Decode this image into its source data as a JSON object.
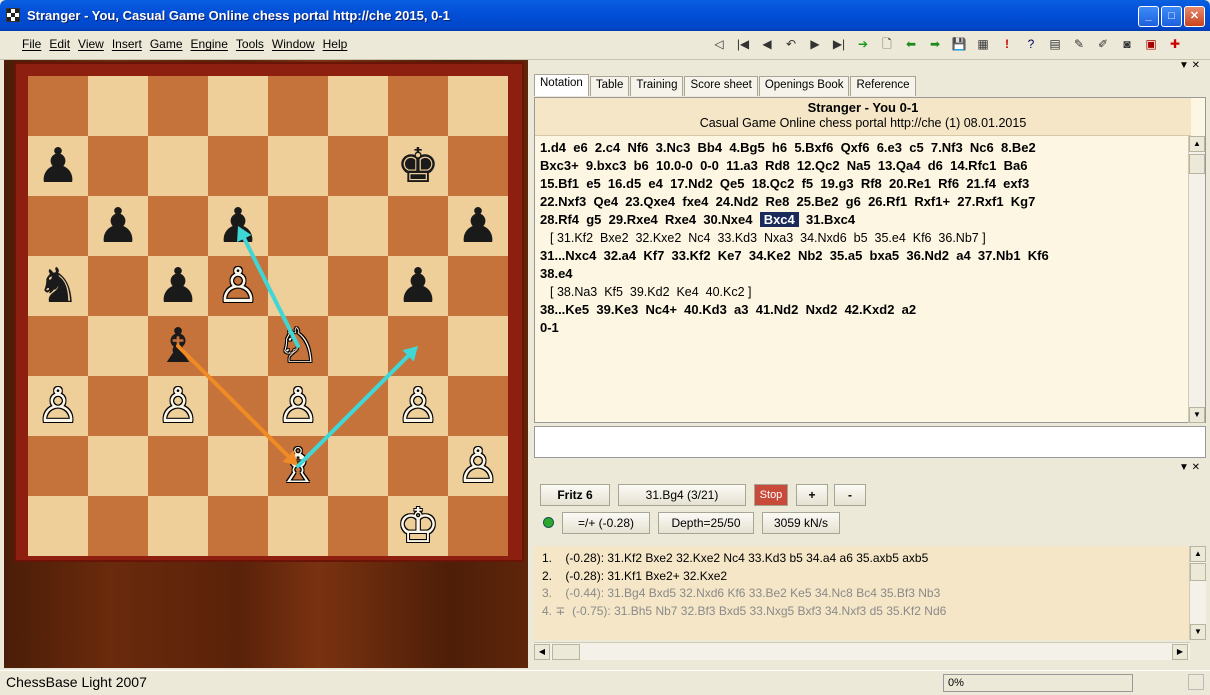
{
  "window": {
    "title": "Stranger - You, Casual Game Online chess portal http://che 2015, 0-1",
    "buttons": [
      "_",
      "□",
      "✕"
    ]
  },
  "menu": [
    "File",
    "Edit",
    "View",
    "Insert",
    "Game",
    "Engine",
    "Tools",
    "Window",
    "Help"
  ],
  "toolbar": [
    "◁",
    "|◀",
    "◀",
    "↶",
    "▶",
    "▶|",
    "➔",
    "🗋",
    "⬅",
    "➡",
    "💾",
    "▦",
    "!",
    "?",
    "▤",
    "✎",
    "✐",
    "◙",
    "▣",
    "✚"
  ],
  "board": {
    "pieces": [
      {
        "sq": "g7",
        "glyph": "♚",
        "color": "b"
      },
      {
        "sq": "a7",
        "glyph": "♟",
        "color": "b"
      },
      {
        "sq": "b6",
        "glyph": "♟",
        "color": "b"
      },
      {
        "sq": "d6",
        "glyph": "♟",
        "color": "b"
      },
      {
        "sq": "h6",
        "glyph": "♟",
        "color": "b"
      },
      {
        "sq": "a5",
        "glyph": "♞",
        "color": "b"
      },
      {
        "sq": "c5",
        "glyph": "♟",
        "color": "b"
      },
      {
        "sq": "d5",
        "glyph": "♙",
        "color": "w"
      },
      {
        "sq": "g5",
        "glyph": "♟",
        "color": "b"
      },
      {
        "sq": "c4",
        "glyph": "♝",
        "color": "b"
      },
      {
        "sq": "e4",
        "glyph": "♘",
        "color": "w"
      },
      {
        "sq": "a3",
        "glyph": "♙",
        "color": "w"
      },
      {
        "sq": "c3",
        "glyph": "♙",
        "color": "w"
      },
      {
        "sq": "e3",
        "glyph": "♙",
        "color": "w"
      },
      {
        "sq": "g3",
        "glyph": "♙",
        "color": "w"
      },
      {
        "sq": "e2",
        "glyph": "♗",
        "color": "w"
      },
      {
        "sq": "h2",
        "glyph": "♙",
        "color": "w"
      },
      {
        "sq": "g1",
        "glyph": "♔",
        "color": "w"
      }
    ],
    "arrows": [
      {
        "from": "c4",
        "to": "e2",
        "color": "#f08a24"
      },
      {
        "from": "e2",
        "to": "g4",
        "color": "#3fd6d6"
      },
      {
        "from": "e4",
        "to": "d6",
        "color": "#3fd6d6"
      }
    ]
  },
  "tabs": [
    "Notation",
    "Table",
    "Training",
    "Score sheet",
    "Openings Book",
    "Reference"
  ],
  "pane_buttons": "▼ ✕",
  "notation": {
    "title": "Stranger - You  0-1",
    "subtitle": "Casual Game Online chess portal http://che (1) 08.01.2015",
    "lines": [
      {
        "t": "m",
        "text": "1.d4  e6  2.c4  Nf6  3.Nc3  Bb4  4.Bg5  h6  5.Bxf6  Qxf6  6.e3  c5  7.Nf3  Nc6  8.Be2"
      },
      {
        "t": "m",
        "text": "Bxc3+  9.bxc3  b6  10.0-0  0-0  11.a3  Rd8  12.Qc2  Na5  13.Qa4  d6  14.Rfc1  Ba6"
      },
      {
        "t": "m",
        "text": "15.Bf1  e5  16.d5  e4  17.Nd2  Qe5  18.Qc2  f5  19.g3  Rf8  20.Re1  Rf6  21.f4  exf3"
      },
      {
        "t": "m",
        "text": "22.Nxf3  Qe4  23.Qxe4  fxe4  24.Nd2  Re8  25.Be2  g6  26.Rf1  Rxf1+  27.Rxf1  Kg7"
      },
      {
        "t": "c",
        "pre": "28.Rf4  g5  29.Rxe4  Rxe4  30.Nxe4  ",
        "cur": "Bxc4",
        "post": "  31.Bxc4"
      },
      {
        "t": "v",
        "text": "[ 31.Kf2  Bxe2  32.Kxe2  Nc4  33.Kd3  Nxa3  34.Nxd6  b5  35.e4  Kf6  36.Nb7 ]"
      },
      {
        "t": "m",
        "text": "31...Nxc4  32.a4  Kf7  33.Kf2  Ke7  34.Ke2  Nb2  35.a5  bxa5  36.Nd2  a4  37.Nb1  Kf6"
      },
      {
        "t": "m",
        "text": "38.e4"
      },
      {
        "t": "v",
        "text": "[ 38.Na3  Kf5  39.Kd2  Ke4  40.Kc2 ]"
      },
      {
        "t": "m",
        "text": "38...Ke5  39.Ke3  Nc4+  40.Kd3  a3  41.Nd2  Nxd2  42.Kxd2  a2"
      },
      {
        "t": "m",
        "text": "0-1"
      }
    ]
  },
  "engine": {
    "name": "Fritz 6",
    "move": "31.Bg4 (3/21)",
    "stop": "Stop",
    "plus": "+",
    "minus": "-",
    "eval": "=/+  (-0.28)",
    "depth": "Depth=25/50",
    "speed": "3059 kN/s",
    "lines": [
      {
        "text": "1.    (-0.28): 31.Kf2 Bxe2 32.Kxe2 Nc4 33.Kd3 b5 34.a4 a6 35.axb5 axb5",
        "grey": false
      },
      {
        "text": "2.    (-0.28): 31.Kf1 Bxe2+ 32.Kxe2",
        "grey": false
      },
      {
        "text": "3.    (-0.44): 31.Bg4 Bxd5 32.Nxd6 Kf6 33.Be2 Ke5 34.Nc8 Bc4 35.Bf3 Nb3",
        "grey": true
      },
      {
        "text": "4. ∓  (-0.75): 31.Bh5 Nb7 32.Bf3 Bxd5 33.Nxg5 Bxf3 34.Nxf3 d5 35.Kf2 Nd6",
        "grey": true
      }
    ]
  },
  "status": {
    "text": "ChessBase Light 2007",
    "progress": "0%"
  }
}
